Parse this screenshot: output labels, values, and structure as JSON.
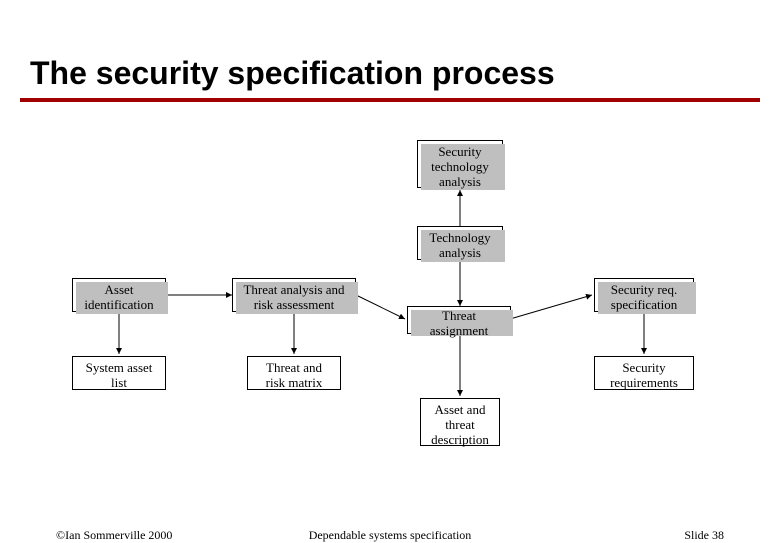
{
  "title": "The security specification process",
  "boxes": {
    "sec_tech_analysis": "Security\ntechnology\nanalysis",
    "tech_analysis": "Technology\nanalysis",
    "asset_ident": "Asset\nidentification",
    "threat_analysis": "Threat analysis and\nrisk assessment",
    "threat_assignment": "Threat\nassignment",
    "sec_req_spec": "Security req.\nspecification",
    "system_asset_list": "System asset\nlist",
    "threat_risk_matrix": "Threat and\nrisk matrix",
    "asset_threat_desc": "Asset and\nthreat\ndescription",
    "sec_requirements": "Security\nrequirements"
  },
  "footer": {
    "left": "©Ian Sommerville 2000",
    "center": "Dependable systems specification",
    "right": "Slide 38"
  }
}
